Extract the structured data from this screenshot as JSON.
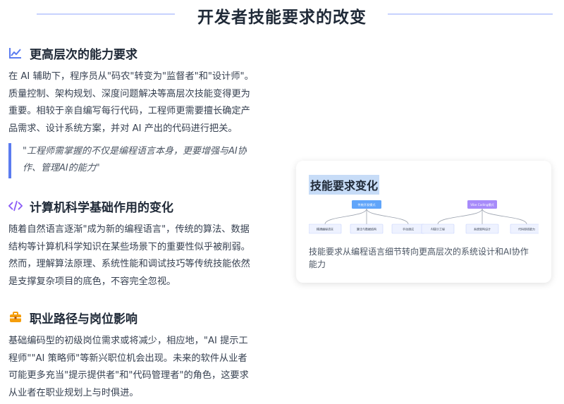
{
  "page": {
    "title": "开发者技能要求的改变"
  },
  "sections": [
    {
      "icon": "chart-line-icon",
      "heading": "更高层次的能力要求",
      "lines": [
        "在 AI 辅助下，程序员从\"码农\"转变为\"监督者\"和\"设计师\"。",
        "质量控制、架构规划、深度问题解决等高层次技能变得更为",
        "重要。相较于亲自编写每行代码，工程师更需要擅长确定产",
        "品需求、设计系统方案，并对 AI 产出的代码进行把关。"
      ],
      "quote_lines": [
        "\"工程师需掌握的不仅是编程语言本身，更要增强与AI协",
        "作、管理AI的能力\""
      ]
    },
    {
      "icon": "code-icon",
      "heading": "计算机科学基础作用的变化",
      "lines": [
        "随着自然语言逐渐\"成为新的编程语言\"，传统的算法、数据",
        "结构等计算机科学知识在某些场景下的重要性似乎被削弱。",
        "然而，理解算法原理、系统性能和调试技巧等传统技能依然",
        "是支撑复杂项目的底色，不容完全忽视。"
      ]
    },
    {
      "icon": "briefcase-icon",
      "heading": "职业路径与岗位影响",
      "lines": [
        "基础编码型的初级岗位需求或将减少，相应地，\"AI 提示工",
        "程师\"\"AI 策略师\"等新兴职位机会出现。未来的软件从业者",
        "可能更多充当\"提示提供者\"和\"代码管理者\"的角色，这要求",
        "从业者在职业规划上与时俱进。"
      ]
    }
  ],
  "card": {
    "title": "技能要求变化",
    "caption_lines": [
      "技能要求从编程语言细节转向更高层次的系统设计和AI协作",
      "能力"
    ],
    "diagram": {
      "left": {
        "root": "传统开发模式",
        "children": [
          "精通编程语言",
          "算法与数据结构",
          "手动调试"
        ]
      },
      "right": {
        "root": "Vibe Coding模式",
        "children": [
          "AI提示工程",
          "系统架构设计",
          "代码审核能力"
        ]
      }
    }
  },
  "colors": {
    "accent_blue": "#5b7cf0",
    "code_purple": "#8b5cf6",
    "briefcase_orange": "#f59e0b",
    "diagram_blue": "#60a5fa",
    "diagram_purple": "#a78bfa"
  }
}
